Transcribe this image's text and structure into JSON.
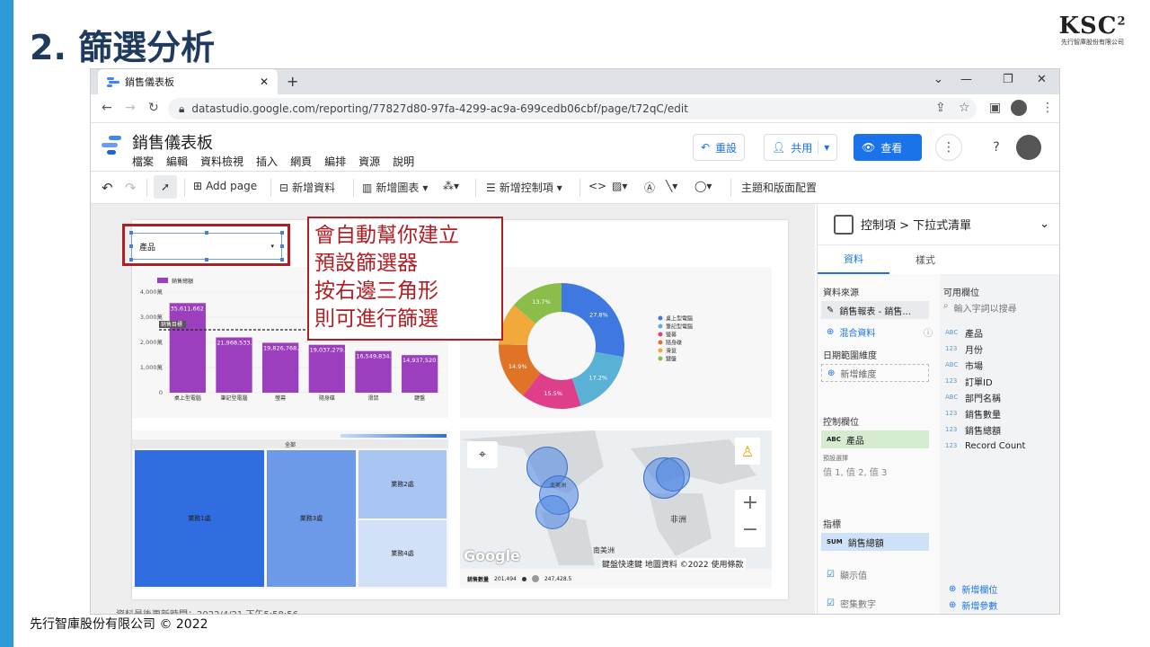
{
  "slide": {
    "title": "2. 篩選分析",
    "logo": "KSC",
    "logo_sup": "2",
    "logo_sub": "先行智庫股份有限公司",
    "footer": "先行智庫股份有限公司 © 2022"
  },
  "browser": {
    "tab_title": "銷售儀表板",
    "url": "datastudio.google.com/reporting/77827d80-97fa-4299-ac9a-699cedb06cbf/page/t72qC/edit"
  },
  "app": {
    "title": "銷售儀表板",
    "menu": [
      "檔案",
      "編輯",
      "資料檢視",
      "插入",
      "網頁",
      "編排",
      "資源",
      "說明"
    ],
    "reset": "重設",
    "share": "共用",
    "view": "查看"
  },
  "toolbar": {
    "add_page": "Add page",
    "add_data": "新增資料",
    "add_chart": "新增圖表",
    "add_control": "新增控制項",
    "theme": "主題和版面配置"
  },
  "dropdown": {
    "label": "產品"
  },
  "callout": {
    "lines": [
      "會自動幫你建立",
      "預設篩選器",
      "按右邊三角形",
      "則可進行篩選"
    ]
  },
  "chart_data": [
    {
      "type": "bar",
      "legend": "銷售總額",
      "categories": [
        "桌上型電腦",
        "筆記型電腦",
        "螢幕",
        "隨身碟",
        "滑鼠",
        "鍵盤"
      ],
      "values": [
        35611662,
        21968533.5,
        19826768.5,
        19037279.5,
        16549834.5,
        14937520
      ],
      "data_labels": [
        "35,611,662",
        "21,968,533.5",
        "19,826,768.5",
        "19,037,279.5",
        "16,549,834.5",
        "14,937,520"
      ],
      "ytick_labels": [
        "4,000萬",
        "3,000萬",
        "2,000萬",
        "1,000萬",
        "0"
      ],
      "ylim": [
        0,
        40000000
      ],
      "reference_label": "銷售目標",
      "reference": 25000000,
      "color": "#9c3fbf"
    },
    {
      "type": "pie",
      "donut": true,
      "slices": [
        {
          "name": "桌上型電腦",
          "value": 27.8,
          "label": "27.8%",
          "color": "#3f78e0"
        },
        {
          "name": "筆記型電腦",
          "value": 17.2,
          "label": "17.2%",
          "color": "#5ab1d6"
        },
        {
          "name": "螢幕",
          "value": 15.5,
          "label": "15.5%",
          "color": "#df3f8a"
        },
        {
          "name": "隨身碟",
          "value": 14.9,
          "label": "14.9%",
          "color": "#e07426"
        },
        {
          "name": "滑鼠",
          "value": 10.9,
          "label": "",
          "color": "#f2a93b"
        },
        {
          "name": "鍵盤",
          "value": 13.7,
          "label": "13.7%",
          "color": "#8bbd4a"
        }
      ]
    }
  ],
  "treemap": {
    "title": "全部",
    "tiles": [
      "業務1處",
      "業務3處",
      "業務2處",
      "業務4處"
    ]
  },
  "map": {
    "labels": [
      "非洲",
      "南美洲",
      "北美洲"
    ],
    "google": "Google",
    "attribution": "鍵盤快速鍵 地圖資料 ©2022 使用條款",
    "legend_title": "銷售數量",
    "legend_min": "201,494",
    "legend_max": "247,428.5"
  },
  "panel": {
    "title": "控制項 > 下拉式清單",
    "tab_data": "資料",
    "tab_style": "樣式",
    "source_label": "資料來源",
    "source": "銷售報表 - 銷售...",
    "blend": "混合資料",
    "date_label": "日期範圍維度",
    "add_dim": "新增維度",
    "control_label": "控制欄位",
    "control_field": "產品",
    "default_label": "預設選擇",
    "default_value": "值 1, 值 2, 值 3",
    "metric_label": "指標",
    "metric": "銷售總額",
    "show_values": "顯示值",
    "compact": "密集數字",
    "avail_label": "可用欄位",
    "search": "輸入字詞以搜尋",
    "fields": [
      {
        "t": "ABC",
        "n": "產品"
      },
      {
        "t": "123",
        "n": "月份"
      },
      {
        "t": "ABC",
        "n": "市場"
      },
      {
        "t": "123",
        "n": "訂單ID"
      },
      {
        "t": "ABC",
        "n": "部門名稱"
      },
      {
        "t": "123",
        "n": "銷售數量"
      },
      {
        "t": "123",
        "n": "銷售總額"
      },
      {
        "t": "123",
        "n": "Record Count"
      }
    ],
    "add_field": "新增欄位",
    "add_param": "新增參數"
  },
  "status": {
    "last_update": "資料最後更新時間：2022/4/21 下午5:58:56"
  }
}
